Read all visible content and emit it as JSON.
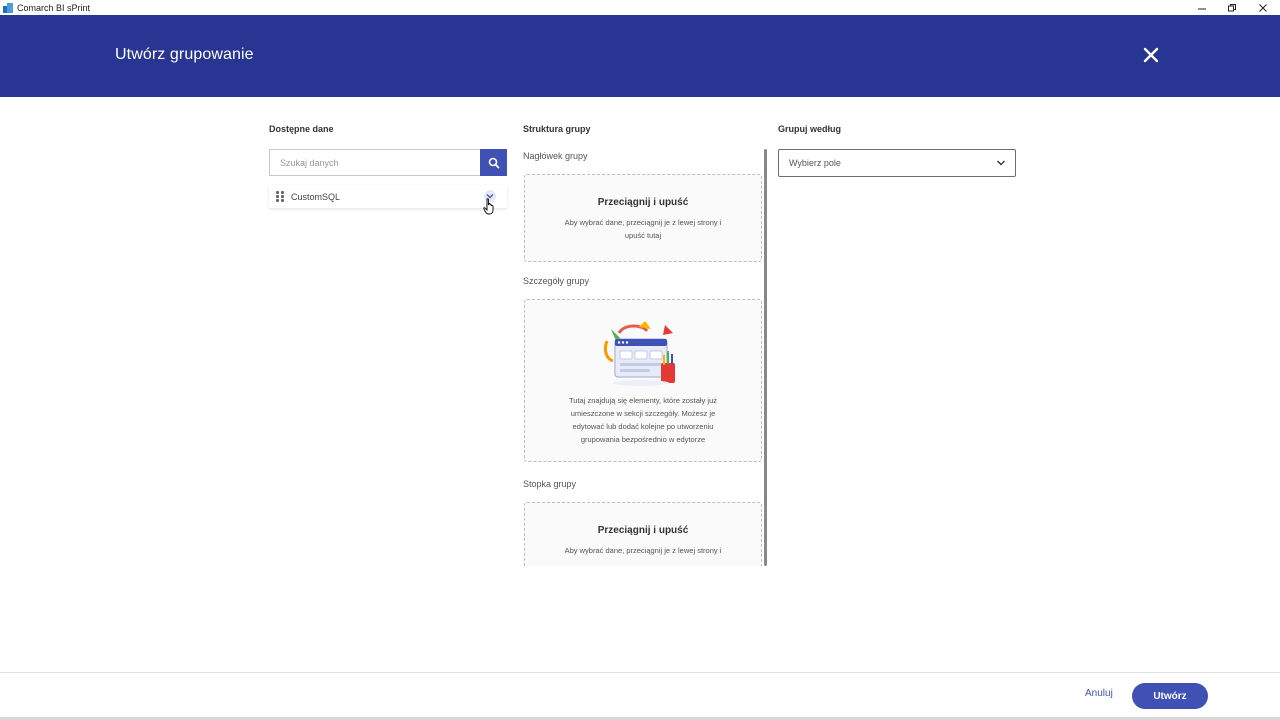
{
  "window": {
    "title": "Comarch BI sPrint",
    "controls": [
      "minimize",
      "restore",
      "close"
    ]
  },
  "dialog": {
    "title": "Utwórz grupowanie"
  },
  "available_data": {
    "title": "Dostępne dane",
    "search_placeholder": "Szukaj danych",
    "items": [
      {
        "label": "CustomSQL"
      }
    ]
  },
  "group_structure": {
    "title": "Struktura grupy",
    "header": {
      "label": "Nagłówek grupy",
      "drop_title": "Przeciągnij i upuść",
      "drop_text_1": "Aby wybrać dane, przeciągnij je z lewej strony i",
      "drop_text_2": "upuść tutaj"
    },
    "details": {
      "label": "Szczegóły grupy",
      "text_1": "Tutaj znajdują się elementy, które zostały już",
      "text_2": "umieszczone w sekcji szczegóły. Możesz je",
      "text_3": "edytować lub dodać kolejne po utworzeniu",
      "text_4": "grupowania bezpośrednio w edytorze"
    },
    "footer": {
      "label": "Stopka grupy",
      "drop_title": "Przeciągnij i upuść",
      "drop_text_1": "Aby wybrać dane, przeciągnij je z lewej strony i"
    }
  },
  "group_by": {
    "title": "Grupuj według",
    "select_placeholder": "Wybierz pole"
  },
  "footer": {
    "cancel_label": "Anuluj",
    "create_label": "Utwórz"
  },
  "colors": {
    "header_bg": "#283593",
    "accent": "#3f51b5"
  }
}
